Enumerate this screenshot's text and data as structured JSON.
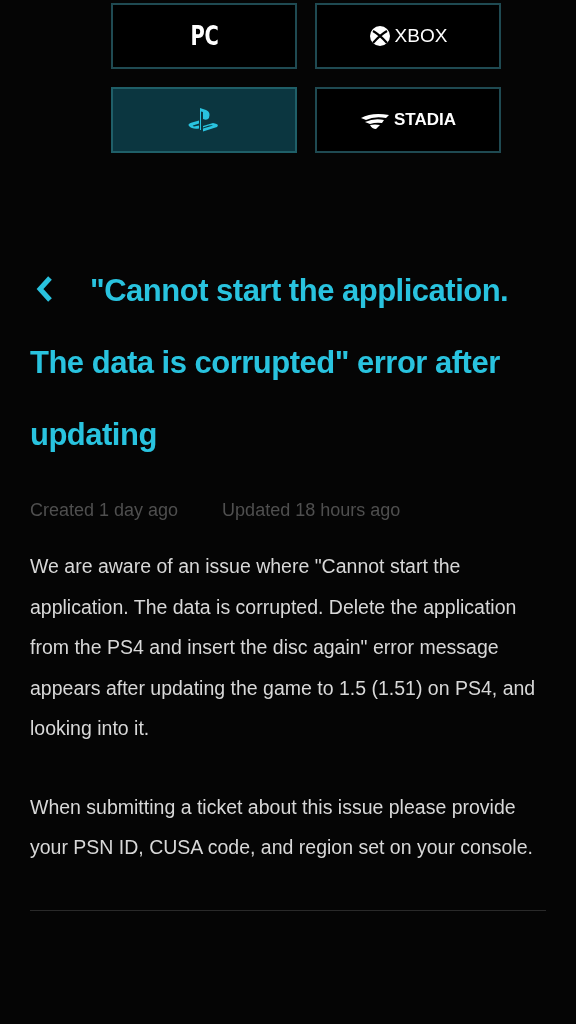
{
  "platforms": [
    {
      "kind": "pc",
      "label": "PC",
      "selected": false
    },
    {
      "kind": "xbox",
      "label": "XBOX",
      "selected": false
    },
    {
      "kind": "playstation",
      "selected": true
    },
    {
      "kind": "stadia",
      "label": "STADIA",
      "selected": false
    }
  ],
  "article": {
    "title": "\"Cannot start the application. The data is corrupted\" error after updating",
    "created": "Created 1 day ago",
    "updated": "Updated 18 hours ago",
    "paragraphs": [
      "We are aware of an issue where \"Cannot start the application. The data is corrupted. Delete the application from the PS4 and insert the disc again\" error message appears after updating the game to 1.5 (1.51) on PS4, and looking into it.",
      "When submitting a ticket about this issue please provide your PSN ID, CUSA code, and region set on your console."
    ]
  }
}
